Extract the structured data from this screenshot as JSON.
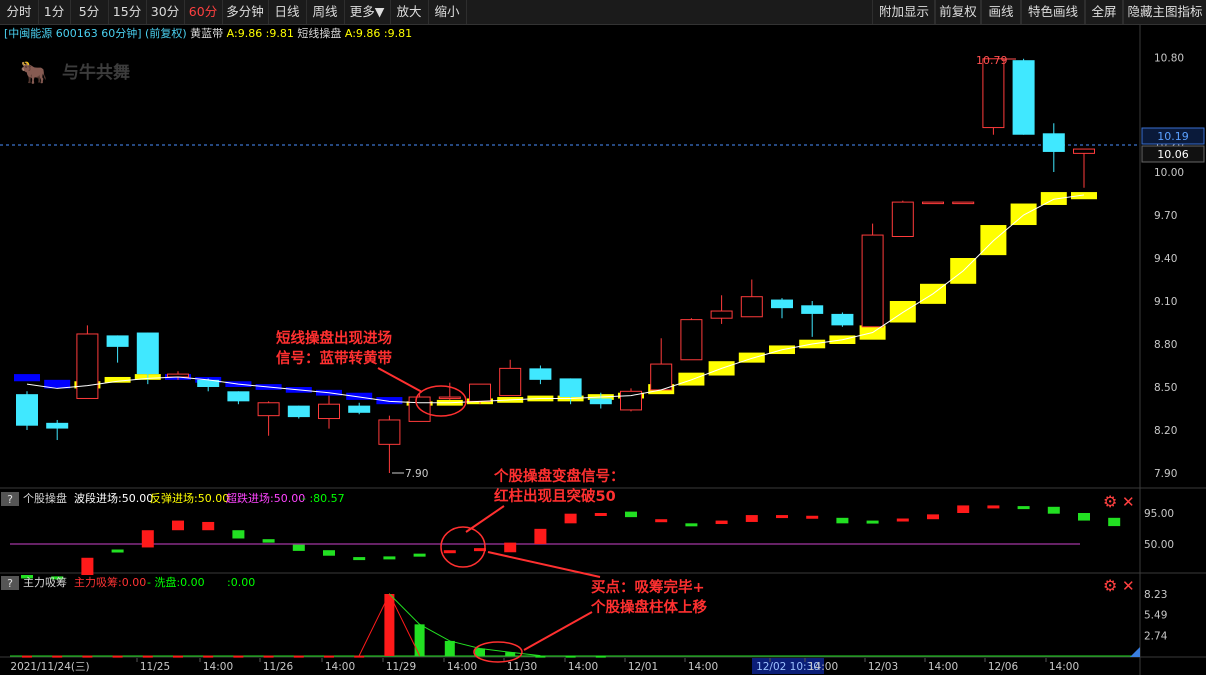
{
  "toolbar": {
    "left": [
      "分时",
      "1分",
      "5分",
      "15分",
      "30分",
      "60分",
      "多分钟",
      "日线",
      "周线",
      "更多▼",
      "放大",
      "缩小"
    ],
    "active": "60分",
    "right": [
      "附加显示",
      "前复权",
      "画线",
      "特色画线",
      "全屏",
      "隐藏主图指标"
    ]
  },
  "info": {
    "stock": "[中闽能源 600163 60分钟] (前复权)",
    "ind1_name": "黄蓝带",
    "ind1_vals": "A:9.86  :9.81",
    "ind2_name": "短线操盘",
    "ind2_vals": "A:9.86  :9.81"
  },
  "watermark": "与牛共舞",
  "annotations": {
    "a1_line1": "短线操盘出现进场",
    "a1_line2": "信号：蓝带转黄带",
    "a2_line1": "个股操盘变盘信号：",
    "a2_line2": "红柱出现且突破50",
    "a3_line1": "买点：吸筹完毕+",
    "a3_line2": "个股操盘柱体上移"
  },
  "subpanel1": {
    "qmark": "?",
    "title": "个股操盘",
    "items": [
      {
        "text": "波段进场:50.00",
        "color": "#ffffff"
      },
      {
        "text": "反弹进场:50.00",
        "color": "#ffff00"
      },
      {
        "text": "超跌进场:50.00",
        "color": "#ff44ff"
      },
      {
        "text": "-  :80.57",
        "color": "#00ff00"
      }
    ]
  },
  "subpanel2": {
    "qmark": "?",
    "title": "主力吸筹",
    "items": [
      {
        "text": "主力吸筹:0.00",
        "color": "#ff3333"
      },
      {
        "text": "-  洗盘:0.00",
        "color": "#00ff00"
      },
      {
        "text": ":0.00",
        "color": "#00ff00"
      }
    ]
  },
  "gear_icon": "gear-icon",
  "close_icon": "close-icon",
  "chart_data": [
    {
      "type": "candlestick",
      "title": "中闽能源 600163 60分钟",
      "ylim": [
        7.8,
        10.9
      ],
      "yticks": [
        "10.80",
        "10.20",
        "10.00",
        "9.70",
        "9.40",
        "9.10",
        "8.80",
        "8.50",
        "8.20",
        "7.90"
      ],
      "price_labels": [
        "10.19",
        "10.06"
      ],
      "high_label": "10.79",
      "low_label": "7.90",
      "x_labels": [
        "2021/11/24(三)",
        "11/25",
        "14:00",
        "11/26",
        "14:00",
        "11/29",
        "14:00",
        "11/30",
        "14:00",
        "12/01",
        "14:00",
        "12/02 10:30",
        "14:00",
        "12/03",
        "14:00",
        "12/06",
        "14:00"
      ],
      "candles": [
        {
          "o": 8.45,
          "h": 8.47,
          "l": 8.2,
          "c": 8.23
        },
        {
          "o": 8.25,
          "h": 8.27,
          "l": 8.13,
          "c": 8.21
        },
        {
          "o": 8.42,
          "h": 8.93,
          "l": 8.42,
          "c": 8.87
        },
        {
          "o": 8.86,
          "h": 8.86,
          "l": 8.67,
          "c": 8.78
        },
        {
          "o": 8.88,
          "h": 8.88,
          "l": 8.52,
          "c": 8.59
        },
        {
          "o": 8.57,
          "h": 8.61,
          "l": 8.55,
          "c": 8.59
        },
        {
          "o": 8.55,
          "h": 8.56,
          "l": 8.47,
          "c": 8.5
        },
        {
          "o": 8.47,
          "h": 8.47,
          "l": 8.38,
          "c": 8.4
        },
        {
          "o": 8.3,
          "h": 8.4,
          "l": 8.16,
          "c": 8.39
        },
        {
          "o": 8.37,
          "h": 8.37,
          "l": 8.28,
          "c": 8.29
        },
        {
          "o": 8.28,
          "h": 8.44,
          "l": 8.21,
          "c": 8.38
        },
        {
          "o": 8.37,
          "h": 8.39,
          "l": 8.31,
          "c": 8.32
        },
        {
          "o": 8.1,
          "h": 8.3,
          "l": 7.9,
          "c": 8.27
        },
        {
          "o": 8.26,
          "h": 8.45,
          "l": 8.26,
          "c": 8.43
        },
        {
          "o": 8.43,
          "h": 8.53,
          "l": 8.41,
          "c": 8.43
        },
        {
          "o": 8.4,
          "h": 8.52,
          "l": 8.38,
          "c": 8.52
        },
        {
          "o": 8.44,
          "h": 8.69,
          "l": 8.44,
          "c": 8.63
        },
        {
          "o": 8.63,
          "h": 8.65,
          "l": 8.52,
          "c": 8.55
        },
        {
          "o": 8.56,
          "h": 8.56,
          "l": 8.38,
          "c": 8.43
        },
        {
          "o": 8.42,
          "h": 8.46,
          "l": 8.35,
          "c": 8.38
        },
        {
          "o": 8.34,
          "h": 8.49,
          "l": 8.33,
          "c": 8.47
        },
        {
          "o": 8.48,
          "h": 8.84,
          "l": 8.48,
          "c": 8.66
        },
        {
          "o": 8.69,
          "h": 8.98,
          "l": 8.69,
          "c": 8.97
        },
        {
          "o": 8.98,
          "h": 9.14,
          "l": 8.94,
          "c": 9.03
        },
        {
          "o": 8.99,
          "h": 9.25,
          "l": 8.99,
          "c": 9.13
        },
        {
          "o": 9.11,
          "h": 9.12,
          "l": 8.98,
          "c": 9.05
        },
        {
          "o": 9.07,
          "h": 9.1,
          "l": 8.85,
          "c": 9.01
        },
        {
          "o": 9.01,
          "h": 9.02,
          "l": 8.92,
          "c": 8.93
        },
        {
          "o": 8.92,
          "h": 9.64,
          "l": 8.92,
          "c": 9.56
        },
        {
          "o": 9.55,
          "h": 9.8,
          "l": 9.55,
          "c": 9.79
        },
        {
          "o": 9.79,
          "h": 9.79,
          "l": 9.79,
          "c": 9.79
        },
        {
          "o": 9.79,
          "h": 9.79,
          "l": 9.79,
          "c": 9.79
        },
        {
          "o": 10.31,
          "h": 10.79,
          "l": 10.26,
          "c": 10.79
        },
        {
          "o": 10.78,
          "h": 10.79,
          "l": 10.26,
          "c": 10.26
        },
        {
          "o": 10.27,
          "h": 10.34,
          "l": 10.0,
          "c": 10.14
        },
        {
          "o": 10.13,
          "h": 10.16,
          "l": 9.89,
          "c": 10.16
        }
      ],
      "yellow_blue_band": [
        {
          "c": "b",
          "lo": 8.54,
          "hi": 8.59
        },
        {
          "c": "b",
          "lo": 8.49,
          "hi": 8.55
        },
        {
          "c": "y",
          "lo": 8.49,
          "hi": 8.54
        },
        {
          "c": "y",
          "lo": 8.53,
          "hi": 8.57
        },
        {
          "c": "y",
          "lo": 8.55,
          "hi": 8.59
        },
        {
          "c": "b",
          "lo": 8.55,
          "hi": 8.59
        },
        {
          "c": "b",
          "lo": 8.53,
          "hi": 8.57
        },
        {
          "c": "b",
          "lo": 8.5,
          "hi": 8.54
        },
        {
          "c": "b",
          "lo": 8.48,
          "hi": 8.52
        },
        {
          "c": "b",
          "lo": 8.46,
          "hi": 8.5
        },
        {
          "c": "b",
          "lo": 8.44,
          "hi": 8.48
        },
        {
          "c": "b",
          "lo": 8.41,
          "hi": 8.46
        },
        {
          "c": "b",
          "lo": 8.38,
          "hi": 8.43
        },
        {
          "c": "y",
          "lo": 8.37,
          "hi": 8.4
        },
        {
          "c": "y",
          "lo": 8.37,
          "hi": 8.41
        },
        {
          "c": "y",
          "lo": 8.38,
          "hi": 8.42
        },
        {
          "c": "y",
          "lo": 8.39,
          "hi": 8.43
        },
        {
          "c": "y",
          "lo": 8.4,
          "hi": 8.44
        },
        {
          "c": "y",
          "lo": 8.4,
          "hi": 8.44
        },
        {
          "c": "y",
          "lo": 8.41,
          "hi": 8.45
        },
        {
          "c": "y",
          "lo": 8.42,
          "hi": 8.46
        },
        {
          "c": "y",
          "lo": 8.45,
          "hi": 8.52
        },
        {
          "c": "y",
          "lo": 8.51,
          "hi": 8.6
        },
        {
          "c": "y",
          "lo": 8.58,
          "hi": 8.68
        },
        {
          "c": "y",
          "lo": 8.67,
          "hi": 8.74
        },
        {
          "c": "y",
          "lo": 8.73,
          "hi": 8.79
        },
        {
          "c": "y",
          "lo": 8.77,
          "hi": 8.83
        },
        {
          "c": "y",
          "lo": 8.8,
          "hi": 8.86
        },
        {
          "c": "y",
          "lo": 8.83,
          "hi": 8.93
        },
        {
          "c": "y",
          "lo": 8.95,
          "hi": 9.1
        },
        {
          "c": "y",
          "lo": 9.08,
          "hi": 9.22
        },
        {
          "c": "y",
          "lo": 9.22,
          "hi": 9.4
        },
        {
          "c": "y",
          "lo": 9.42,
          "hi": 9.63
        },
        {
          "c": "y",
          "lo": 9.63,
          "hi": 9.78
        },
        {
          "c": "y",
          "lo": 9.77,
          "hi": 9.86
        },
        {
          "c": "y",
          "lo": 9.81,
          "hi": 9.86
        }
      ],
      "short_line": [
        8.52,
        8.49,
        8.51,
        8.54,
        8.56,
        8.57,
        8.55,
        8.52,
        8.5,
        8.48,
        8.46,
        8.43,
        8.4,
        8.39,
        8.39,
        8.4,
        8.41,
        8.42,
        8.42,
        8.43,
        8.44,
        8.48,
        8.55,
        8.63,
        8.7,
        8.76,
        8.8,
        8.83,
        8.88,
        9.02,
        9.15,
        9.31,
        9.52,
        9.7,
        9.81,
        9.84
      ]
    },
    {
      "type": "bar",
      "title": "个股操盘",
      "ylim": [
        0,
        120
      ],
      "yticks": [
        "95.00",
        "50.00"
      ],
      "reference_line": 50,
      "bars": [
        {
          "lo": 0,
          "hi": 5,
          "c": "g"
        },
        {
          "lo": 0,
          "hi": 3,
          "c": "g"
        },
        {
          "lo": 5,
          "hi": 30,
          "c": "r"
        },
        {
          "lo": 40,
          "hi": 42,
          "c": "g"
        },
        {
          "lo": 45,
          "hi": 70,
          "c": "r"
        },
        {
          "lo": 70,
          "hi": 84,
          "c": "r"
        },
        {
          "lo": 70,
          "hi": 82,
          "c": "r"
        },
        {
          "lo": 58,
          "hi": 70,
          "c": "g"
        },
        {
          "lo": 52,
          "hi": 57,
          "c": "g"
        },
        {
          "lo": 40,
          "hi": 49,
          "c": "g"
        },
        {
          "lo": 33,
          "hi": 41,
          "c": "g"
        },
        {
          "lo": 27,
          "hi": 31,
          "c": "g"
        },
        {
          "lo": 30,
          "hi": 32,
          "c": "g"
        },
        {
          "lo": 34,
          "hi": 36,
          "c": "g"
        },
        {
          "lo": 39,
          "hi": 41,
          "c": "r"
        },
        {
          "lo": 43,
          "hi": 44,
          "c": "r"
        },
        {
          "lo": 38,
          "hi": 52,
          "c": "r"
        },
        {
          "lo": 50,
          "hi": 72,
          "c": "r"
        },
        {
          "lo": 80,
          "hi": 94,
          "c": "r"
        },
        {
          "lo": 92,
          "hi": 95,
          "c": "r"
        },
        {
          "lo": 89,
          "hi": 97,
          "c": "g"
        },
        {
          "lo": 83,
          "hi": 86,
          "c": "r"
        },
        {
          "lo": 76,
          "hi": 80,
          "c": "g"
        },
        {
          "lo": 79,
          "hi": 84,
          "c": "r"
        },
        {
          "lo": 82,
          "hi": 92,
          "c": "r"
        },
        {
          "lo": 89,
          "hi": 92,
          "c": "r"
        },
        {
          "lo": 88,
          "hi": 91,
          "c": "r"
        },
        {
          "lo": 80,
          "hi": 88,
          "c": "g"
        },
        {
          "lo": 80,
          "hi": 84,
          "c": "g"
        },
        {
          "lo": 83,
          "hi": 87,
          "c": "r"
        },
        {
          "lo": 86,
          "hi": 93,
          "c": "r"
        },
        {
          "lo": 95,
          "hi": 106,
          "c": "r"
        },
        {
          "lo": 104,
          "hi": 106,
          "c": "r"
        },
        {
          "lo": 103,
          "hi": 105,
          "c": "g"
        },
        {
          "lo": 94,
          "hi": 104,
          "c": "g"
        },
        {
          "lo": 84,
          "hi": 95,
          "c": "g"
        },
        {
          "lo": 76,
          "hi": 88,
          "c": "g"
        }
      ]
    },
    {
      "type": "bar",
      "title": "主力吸筹",
      "ylim": [
        0,
        9.2
      ],
      "yticks": [
        "8.23",
        "5.49",
        "2.74"
      ],
      "bars": [
        {
          "v": 0.05,
          "c": "r"
        },
        {
          "v": 0.05,
          "c": "r"
        },
        {
          "v": 0.05,
          "c": "r"
        },
        {
          "v": 0.05,
          "c": "r"
        },
        {
          "v": 0.05,
          "c": "r"
        },
        {
          "v": 0.05,
          "c": "r"
        },
        {
          "v": 0.05,
          "c": "r"
        },
        {
          "v": 0.05,
          "c": "r"
        },
        {
          "v": 0.05,
          "c": "r"
        },
        {
          "v": 0.05,
          "c": "r"
        },
        {
          "v": 0.05,
          "c": "r"
        },
        {
          "v": 0.05,
          "c": "r"
        },
        {
          "v": 8.23,
          "c": "r"
        },
        {
          "v": 4.2,
          "c": "g"
        },
        {
          "v": 2.0,
          "c": "g"
        },
        {
          "v": 1.0,
          "c": "g"
        },
        {
          "v": 0.5,
          "c": "g"
        },
        {
          "v": 0.05,
          "c": "g"
        },
        {
          "v": 0.05,
          "c": "g"
        },
        {
          "v": 0.05,
          "c": "g"
        }
      ]
    }
  ]
}
